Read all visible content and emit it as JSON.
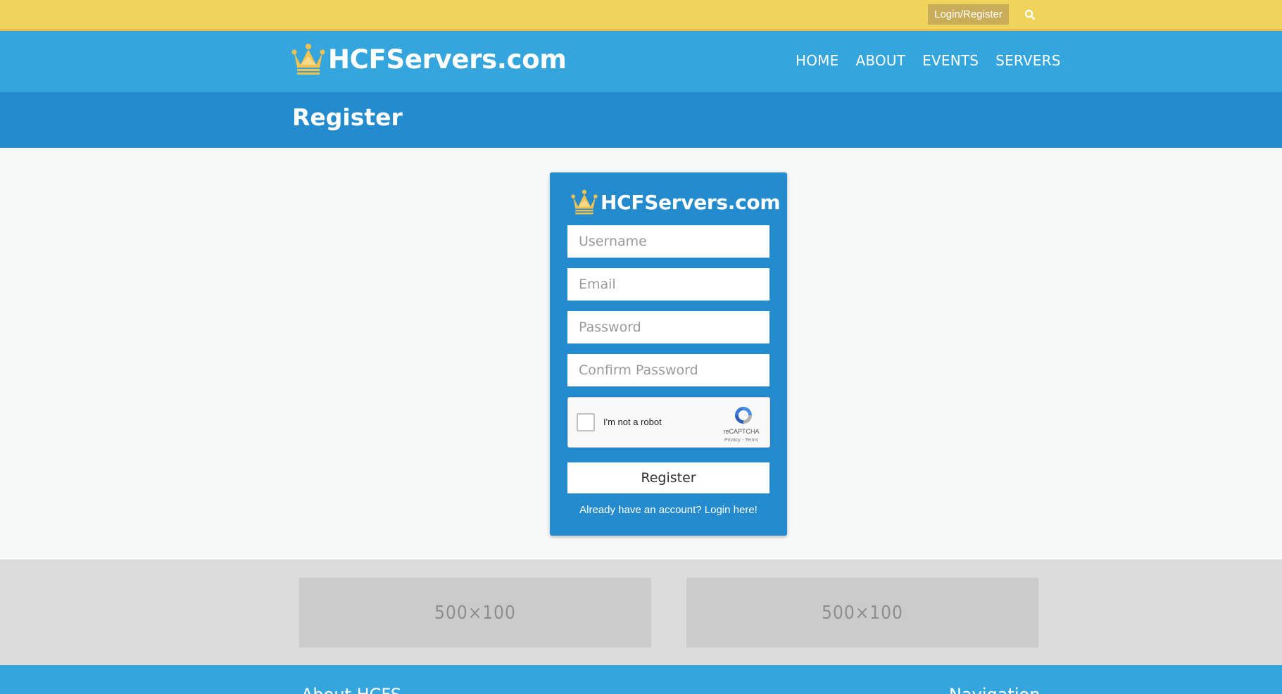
{
  "topbar": {
    "login_label": "Login/Register"
  },
  "header": {
    "logo_text": "HCFServers.com",
    "nav": [
      "HOME",
      "ABOUT",
      "EVENTS",
      "SERVERS"
    ]
  },
  "page": {
    "title": "Register"
  },
  "form": {
    "logo_text": "HCFServers.com",
    "username_placeholder": "Username",
    "email_placeholder": "Email",
    "password_placeholder": "Password",
    "confirm_password_placeholder": "Confirm Password",
    "recaptcha_label": "I'm not a robot",
    "recaptcha_brand": "reCAPTCHA",
    "recaptcha_terms": "Privacy - Terms",
    "submit_label": "Register",
    "login_link": "Already have an account? Login here!"
  },
  "ads": [
    "500×100",
    "500×100"
  ],
  "footer": {
    "about_heading": "About HCFS",
    "nav_heading": "Navigation"
  },
  "colors": {
    "topbar": "#f0d35a",
    "header": "#35a6dd",
    "titlebar": "#238bce",
    "accent_gold": "#f2c14e"
  },
  "icons": [
    "crown-icon",
    "search-icon",
    "recaptcha-logo-icon"
  ]
}
